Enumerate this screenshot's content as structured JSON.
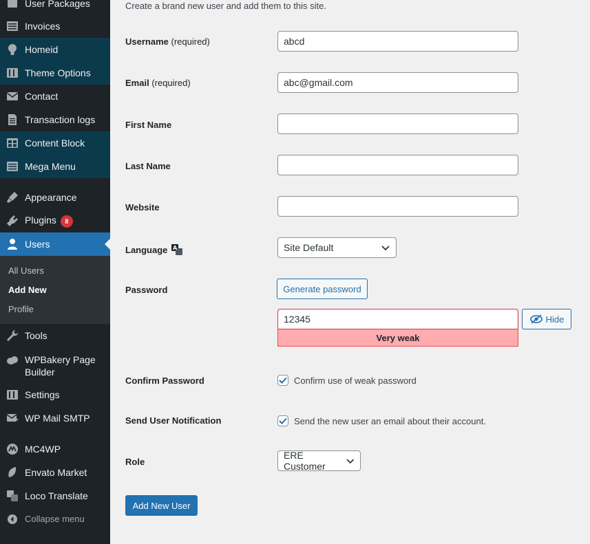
{
  "sidebar": {
    "items": [
      {
        "label": "User Packages",
        "icon": "packages-icon"
      },
      {
        "label": "Invoices",
        "icon": "list-icon"
      },
      {
        "label": "Homeid",
        "icon": "lightbulb-icon"
      },
      {
        "label": "Theme Options",
        "icon": "settings-sliders-icon"
      },
      {
        "label": "Contact",
        "icon": "email-icon"
      },
      {
        "label": "Transaction logs",
        "icon": "document-icon"
      },
      {
        "label": "Content Block",
        "icon": "table-icon"
      },
      {
        "label": "Mega Menu",
        "icon": "list-icon"
      },
      {
        "label": "Appearance",
        "icon": "paintbrush-icon"
      },
      {
        "label": "Plugins",
        "icon": "plugin-icon",
        "badge": "8"
      },
      {
        "label": "Users",
        "icon": "user-icon"
      },
      {
        "label": "Tools",
        "icon": "wrench-icon"
      },
      {
        "label": "WPBakery Page Builder",
        "icon": "cloud-icon"
      },
      {
        "label": "Settings",
        "icon": "settings-sliders-icon"
      },
      {
        "label": "WP Mail SMTP",
        "icon": "mail-arrow-icon"
      },
      {
        "label": "MC4WP",
        "icon": "mc4wp-icon"
      },
      {
        "label": "Envato Market",
        "icon": "leaf-icon"
      },
      {
        "label": "Loco Translate",
        "icon": "translate-icon"
      }
    ],
    "submenu": [
      "All Users",
      "Add New",
      "Profile"
    ],
    "collapse_label": "Collapse menu"
  },
  "form": {
    "description": "Create a brand new user and add them to this site.",
    "username": {
      "label": "Username",
      "req": "(required)",
      "value": "abcd"
    },
    "email": {
      "label": "Email",
      "req": "(required)",
      "value": "abc@gmail.com"
    },
    "first_name": {
      "label": "First Name",
      "value": ""
    },
    "last_name": {
      "label": "Last Name",
      "value": ""
    },
    "website": {
      "label": "Website",
      "value": ""
    },
    "language": {
      "label": "Language",
      "value": "Site Default"
    },
    "password": {
      "label": "Password",
      "generate": "Generate password",
      "value": "12345",
      "hide": "Hide",
      "strength": "Very weak"
    },
    "confirm_password": {
      "label": "Confirm Password",
      "checkbox": "Confirm use of weak password",
      "checked": true
    },
    "notification": {
      "label": "Send User Notification",
      "checkbox": "Send the new user an email about their account.",
      "checked": true
    },
    "role": {
      "label": "Role",
      "value": "ERE Customer"
    },
    "submit": "Add New User"
  },
  "colors": {
    "accent": "#2271b1",
    "sidebar": "#1d2327",
    "weak": "#ffabaf"
  }
}
